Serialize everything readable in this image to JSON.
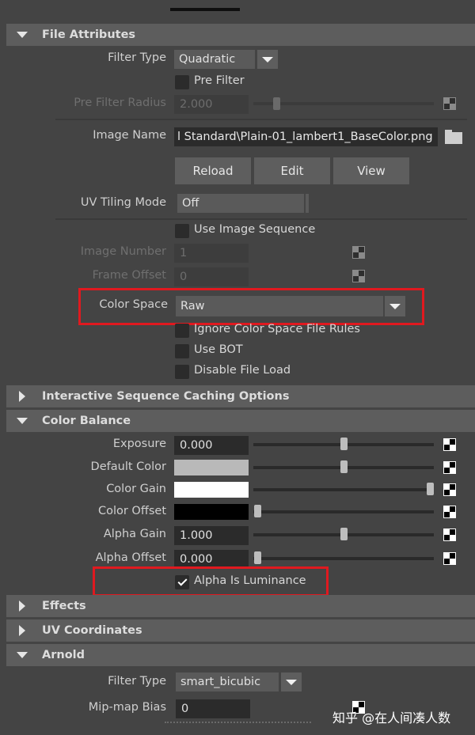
{
  "sections": {
    "file_attributes": "File Attributes",
    "interactive_caching": "Interactive Sequence Caching Options",
    "color_balance": "Color Balance",
    "effects": "Effects",
    "uv_coordinates": "UV Coordinates",
    "arnold": "Arnold"
  },
  "file_attributes": {
    "filter_type_label": "Filter Type",
    "filter_type_value": "Quadratic",
    "pre_filter_label": "Pre Filter",
    "pre_filter_checked": false,
    "pre_filter_radius_label": "Pre Filter Radius",
    "pre_filter_radius_value": "2.000",
    "image_name_label": "Image Name",
    "image_name_value": "l Standard\\Plain-01_lambert1_BaseColor.png",
    "reload_label": "Reload",
    "edit_label": "Edit",
    "view_label": "View",
    "uv_tiling_label": "UV Tiling Mode",
    "uv_tiling_value": "Off",
    "use_image_sequence_label": "Use Image Sequence",
    "image_number_label": "Image Number",
    "image_number_value": "1",
    "frame_offset_label": "Frame Offset",
    "frame_offset_value": "0",
    "color_space_label": "Color Space",
    "color_space_value": "Raw",
    "ignore_rules_label": "Ignore Color Space File Rules",
    "use_bot_label": "Use BOT",
    "disable_file_load_label": "Disable File Load"
  },
  "color_balance": {
    "exposure_label": "Exposure",
    "exposure_value": "0.000",
    "exposure_slider": 0.5,
    "default_color_label": "Default Color",
    "default_color": "#b9b9b9",
    "default_color_slider": 0.5,
    "color_gain_label": "Color Gain",
    "color_gain": "#ffffff",
    "color_gain_slider": 1.0,
    "color_offset_label": "Color Offset",
    "color_offset": "#000000",
    "color_offset_slider": 0.0,
    "alpha_gain_label": "Alpha Gain",
    "alpha_gain_value": "1.000",
    "alpha_gain_slider": 0.5,
    "alpha_offset_label": "Alpha Offset",
    "alpha_offset_value": "0.000",
    "alpha_offset_slider": 0.0,
    "alpha_is_luminance_label": "Alpha Is Luminance",
    "alpha_is_luminance_checked": true
  },
  "arnold": {
    "filter_type_label": "Filter Type",
    "filter_type_value": "smart_bicubic",
    "mipmap_bias_label": "Mip-map Bias",
    "mipmap_bias_value": "0"
  },
  "watermark": "知乎 @在人间凑人数",
  "colors": {
    "background": "#444444",
    "section_header": "#5d5d5d",
    "field": "#2b2b2b",
    "highlight_box": "#e0191f"
  }
}
